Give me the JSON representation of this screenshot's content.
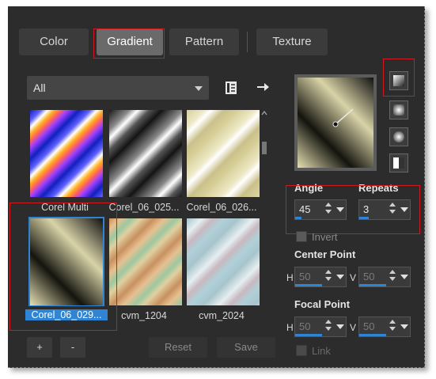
{
  "tabs": [
    {
      "label": "Color"
    },
    {
      "label": "Gradient"
    },
    {
      "label": "Pattern"
    },
    {
      "label": "Texture"
    }
  ],
  "category_select": {
    "value": "All"
  },
  "gradients": [
    {
      "name": "Corel Multi"
    },
    {
      "name": "Corel_06_025..."
    },
    {
      "name": "Corel_06_026..."
    },
    {
      "name": "Corel_06_029..."
    },
    {
      "name": "cvm_1204"
    },
    {
      "name": "cvm_2024"
    }
  ],
  "angle": {
    "label": "Angle",
    "value": "45"
  },
  "repeats": {
    "label": "Repeats",
    "value": "3"
  },
  "invert": {
    "label": "Invert"
  },
  "center_point": {
    "label": "Center Point",
    "h_label": "H",
    "v_label": "V",
    "h": "50",
    "v": "50"
  },
  "focal_point": {
    "label": "Focal Point",
    "h_label": "H",
    "v_label": "V",
    "h": "50",
    "v": "50"
  },
  "link": {
    "label": "Link"
  },
  "buttons": {
    "add": "+",
    "remove": "-",
    "reset": "Reset",
    "save": "Save"
  },
  "colors": {
    "accent": "#2f85d3",
    "highlight": "#d01a22",
    "panel": "#2c2c2c"
  }
}
